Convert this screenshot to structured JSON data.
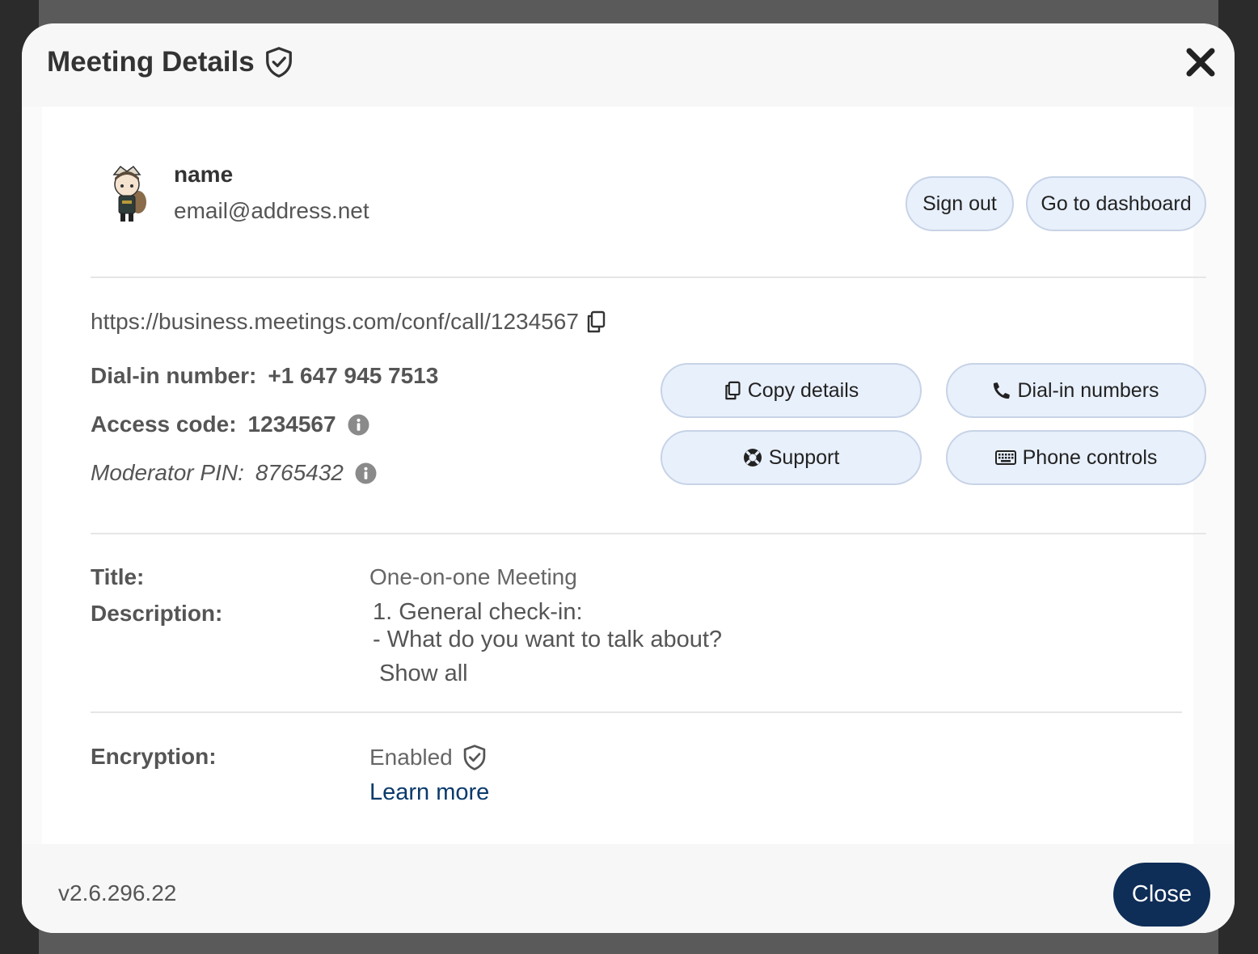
{
  "header": {
    "title": "Meeting Details"
  },
  "user": {
    "name": "name",
    "email": "email@address.net"
  },
  "actions": {
    "sign_out": "Sign out",
    "dashboard": "Go to dashboard"
  },
  "meeting": {
    "url": "https://business.meetings.com/conf/call/1234567",
    "dial_in_label": "Dial-in number:",
    "dial_in_value": "+1 647 945 7513",
    "access_label": "Access code:",
    "access_value": "1234567",
    "pin_label": "Moderator PIN:",
    "pin_value": "8765432"
  },
  "buttons": {
    "copy_details": "Copy details",
    "dial_in_numbers": "Dial-in numbers",
    "support": "Support",
    "phone_controls": "Phone controls"
  },
  "details": {
    "title_label": "Title:",
    "title_value": "One-on-one Meeting",
    "description_label": "Description:",
    "description_line1": "1. General check-in:",
    "description_line2": "- What do you want to talk about?",
    "show_all": "Show all",
    "encryption_label": "Encryption:",
    "encryption_value": "Enabled",
    "learn_more": "Learn more"
  },
  "footer": {
    "version": "v2.6.296.22",
    "close": "Close"
  },
  "icons": [
    "shield-check-icon",
    "close-icon",
    "copy-icon",
    "phone-icon",
    "lifebuoy-icon",
    "keyboard-icon",
    "info-icon"
  ],
  "colors": {
    "accent": "#0e2d57",
    "pill_bg": "#e8f0fc",
    "link": "#0a3a6b"
  }
}
